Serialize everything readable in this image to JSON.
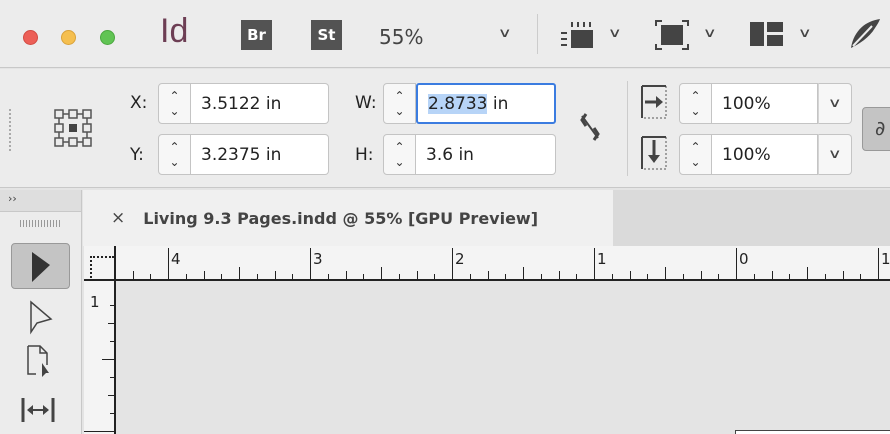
{
  "app": {
    "logo": "Id",
    "bridge_label": "Br",
    "stock_label": "St",
    "zoom": "55%"
  },
  "control": {
    "x_label": "X:",
    "x_value": "3.5122 in",
    "y_label": "Y:",
    "y_value": "3.2375 in",
    "w_label": "W:",
    "w_value_selected": "2.8733",
    "w_value_unit": " in",
    "h_label": "H:",
    "h_value": "3.6 in",
    "scale_x": "100%",
    "scale_y": "100%"
  },
  "document_tab": {
    "close": "×",
    "title": "Living 9.3 Pages.indd @ 55% [GPU Preview]"
  },
  "toolbox": {
    "collapse": "››"
  },
  "ruler": {
    "h_labels": [
      "4",
      "3",
      "2",
      "1",
      "0",
      "1"
    ],
    "v_labels": [
      "1"
    ]
  },
  "colors": {
    "accent": "#3b7ce0",
    "indesign": "#6d3e54",
    "selection": "#b7d4f7"
  }
}
